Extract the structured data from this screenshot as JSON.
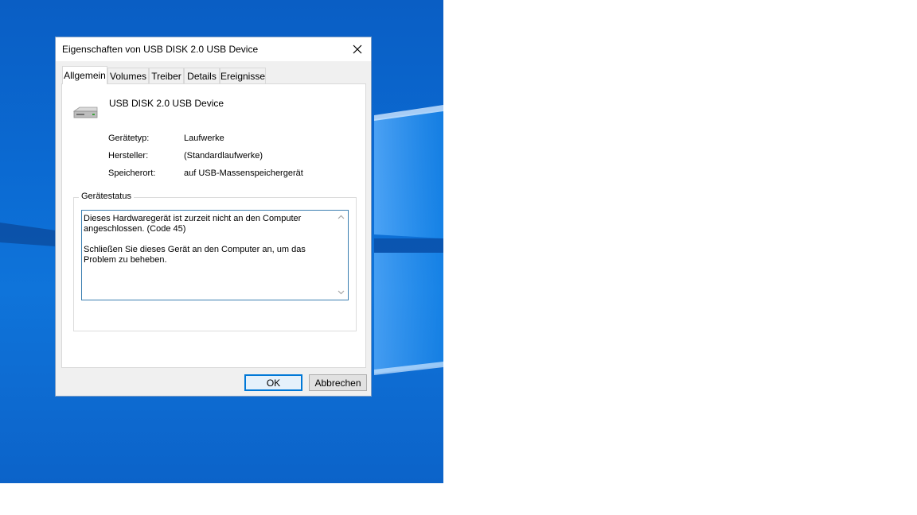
{
  "window": {
    "title": "Eigenschaften von USB DISK 2.0 USB Device"
  },
  "tabs": [
    {
      "label": "Allgemein",
      "active": true
    },
    {
      "label": "Volumes",
      "active": false
    },
    {
      "label": "Treiber",
      "active": false
    },
    {
      "label": "Details",
      "active": false
    },
    {
      "label": "Ereignisse",
      "active": false
    }
  ],
  "device": {
    "name": "USB DISK 2.0 USB Device",
    "icon": "drive-icon",
    "properties": [
      {
        "label": "Gerätetyp:",
        "value": "Laufwerke"
      },
      {
        "label": "Hersteller:",
        "value": "(Standardlaufwerke)"
      },
      {
        "label": "Speicherort:",
        "value": "auf USB-Massenspeichergerät"
      }
    ]
  },
  "status": {
    "legend": "Gerätestatus",
    "paragraph1": "Dieses Hardwaregerät ist zurzeit nicht an den Computer angeschlossen. (Code 45)",
    "paragraph2": "Schließen Sie dieses Gerät an den Computer an, um das Problem zu beheben."
  },
  "buttons": {
    "ok": "OK",
    "cancel": "Abbrechen"
  },
  "colors": {
    "desktop": "#0b6ad2",
    "accent": "#0078d7"
  }
}
